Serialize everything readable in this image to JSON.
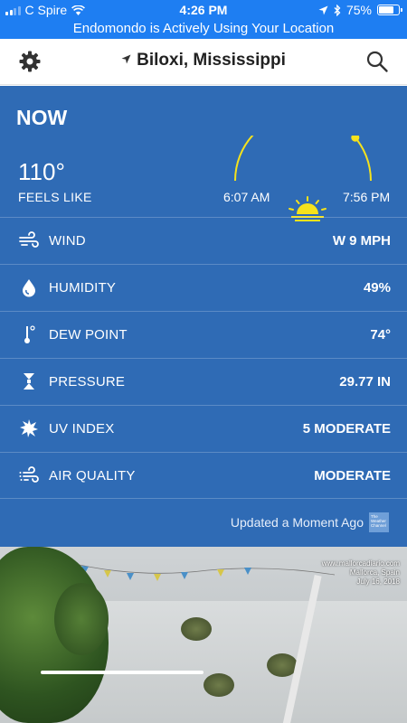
{
  "status_bar": {
    "carrier": "C Spire",
    "time": "4:26 PM",
    "battery": "75%",
    "battery_level": 0.75
  },
  "banner": {
    "text": "Endomondo is Actively Using Your Location"
  },
  "header": {
    "location": "Biloxi, Mississippi"
  },
  "now": {
    "title": "NOW",
    "temperature": "110°",
    "feels_like_label": "FEELS LIKE",
    "sunrise": "6:07 AM",
    "sunset": "7:56 PM",
    "sun_progress": 0.78
  },
  "conditions": [
    {
      "icon": "wind-icon",
      "label": "WIND",
      "value": "W 9 MPH"
    },
    {
      "icon": "humidity-icon",
      "label": "HUMIDITY",
      "value": "49%"
    },
    {
      "icon": "thermometer-icon",
      "label": "DEW POINT",
      "value": "74°"
    },
    {
      "icon": "pressure-icon",
      "label": "PRESSURE",
      "value": "29.77 IN"
    },
    {
      "icon": "uv-index-icon",
      "label": "UV INDEX",
      "value": "5 MODERATE"
    },
    {
      "icon": "air-quality-icon",
      "label": "AIR QUALITY",
      "value": "MODERATE"
    }
  ],
  "updated": "Updated a Moment Ago",
  "video": {
    "watermark_site": "www.mallorcadiario.com",
    "watermark_place": "Mallorca, Spain",
    "watermark_date": "July 16, 2018"
  },
  "colors": {
    "status_blue": "#1e7ef2",
    "panel_blue": "#2f6bb5",
    "sun_yellow": "#f5e21c"
  }
}
